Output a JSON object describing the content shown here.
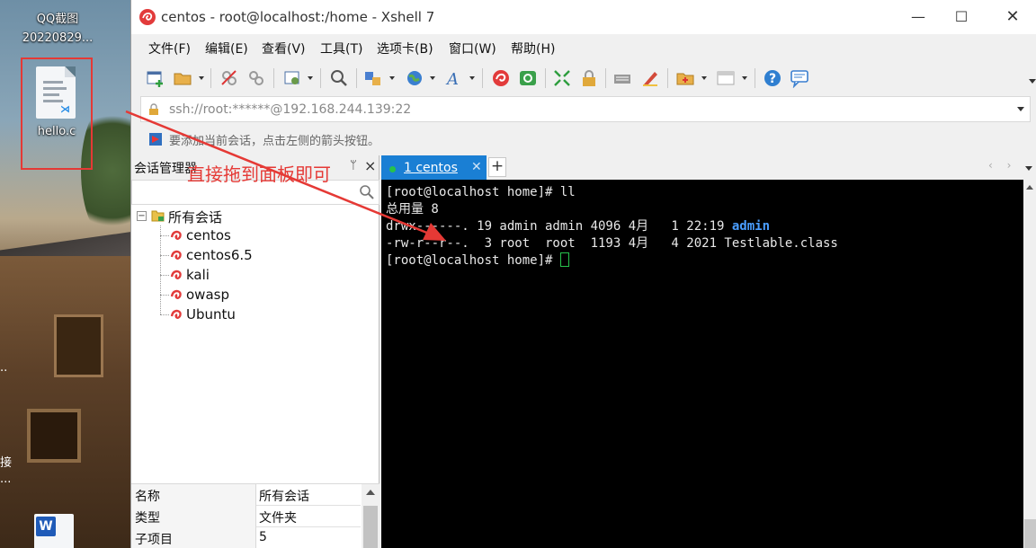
{
  "desktop": {
    "qq_label": "QQ截图",
    "qq_date": "20220829...",
    "file_label": "hello.c",
    "side_text_1": "..",
    "side_text_2a": "接",
    "side_text_2b": "..."
  },
  "window": {
    "title": "centos - root@localhost:/home - Xshell 7",
    "controls": {
      "minimize": "—",
      "maximize": "☐",
      "close": "✕"
    }
  },
  "menu": [
    "文件(F)",
    "编辑(E)",
    "查看(V)",
    "工具(T)",
    "选项卡(B)",
    "窗口(W)",
    "帮助(H)"
  ],
  "toolbar": {
    "icons": [
      "new-session-icon",
      "open-folder-icon",
      "disconnect-icon",
      "reconnect-icon",
      "properties-icon",
      "find-icon",
      "transfer-icon",
      "globe-icon",
      "font-icon",
      "xshell-icon",
      "xftp-icon",
      "fullscreen-icon",
      "lock-icon",
      "keyboard-icon",
      "highlight-icon",
      "compose-icon",
      "layout-icon",
      "help-icon",
      "chat-icon"
    ]
  },
  "address": {
    "value": "ssh://root:******@192.168.244.139:22"
  },
  "hint": {
    "text": "要添加当前会话，点击左侧的箭头按钮。"
  },
  "session_panel": {
    "title": "会话管理器",
    "pin": "ᛘ",
    "close": "×",
    "search_placeholder": "",
    "root": {
      "toggle": "−",
      "label": "所有会话"
    },
    "sessions": [
      "centos",
      "centos6.5",
      "kali",
      "owasp",
      "Ubuntu"
    ],
    "properties": [
      {
        "key": "名称",
        "value": "所有会话"
      },
      {
        "key": "类型",
        "value": "文件夹"
      },
      {
        "key": "子项目",
        "value": "5"
      }
    ]
  },
  "tabs": {
    "active": {
      "label": "1 centos",
      "close": "✕"
    },
    "add": "+",
    "nav": "‹ ›"
  },
  "terminal": {
    "lines": [
      "[root@localhost home]# ll",
      "总用量 8",
      "drwx------. 19 admin admin 4096 4月   1 22:19 ",
      "-rw-r--r--.  3 root  root  1193 4月   4 2021 Testlable.class",
      "[root@localhost home]# "
    ],
    "dir_name": "admin"
  },
  "annotation": {
    "text": "直接拖到面板即可",
    "color": "#e53935"
  },
  "colors": {
    "accent": "#1a7fd4",
    "terminal_bg": "#000000",
    "terminal_fg": "#e8e8e8",
    "dir_color": "#4a9eff",
    "cursor": "#27c24c",
    "annotation": "#e53935"
  }
}
